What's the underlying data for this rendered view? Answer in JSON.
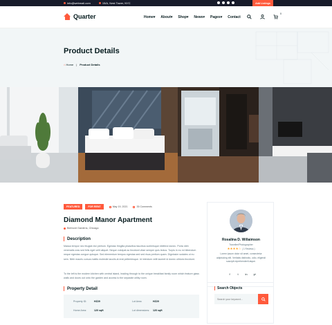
{
  "topbar": {
    "email": "info@webmail.com",
    "address": "15/A, Nest Tower, NYC",
    "cta": "Add Listings"
  },
  "brand": {
    "name": "Quarter"
  },
  "menu": {
    "items": [
      "Home",
      "About",
      "Shop",
      "News",
      "Pages",
      "Contact"
    ]
  },
  "cart": {
    "count": "0"
  },
  "hero": {
    "title": "Product Details",
    "crumb_home": "Home",
    "crumb_current": "Product Details"
  },
  "listing": {
    "badge1": "FEATURED",
    "badge2": "FOR RENT",
    "date": "May 19, 2021",
    "comments": "35 Comments",
    "title": "Diamond Manor Apartment",
    "location": "Belmont Gardens, Chicago",
    "description_heading": "Description",
    "description_p1": "Massa tempor nec feugiat nisl pretium. Egestas fringilla phasellus faucibus scelerisque eleifend donec. Porta nibh venenatis cras sed felis eget velit aliquet. Neque volutpat ac tincidunt vitae semper quis lectus. Turpis in eu mi bibendum neque egestas congue quisque. Sed elementum tempus egestas sed sed risus pretium quam. Dignissim sodales ut eu sem. Nibh mauris cursus mattis molestie iaculis at erat pellentesque. Id interdum velit laoreet id donec ultrices tincidunt.",
    "description_p2": "To the left is the modern kitchen with central island, leading through to the unique breakfast family room which feature glass walls and doors out onto the garden and access to the separate utility room.",
    "detail_heading": "Property Detail",
    "details": [
      {
        "l1": "Property ID:",
        "v1": "HZ29",
        "l2": "Lot Area:",
        "v2": "HZ29"
      },
      {
        "l1": "Home Area:",
        "v1": "120 sqft",
        "l2": "Lot dimensions:",
        "v2": "120 sqft"
      }
    ]
  },
  "agent": {
    "name": "Rosalina D. Willaimson",
    "role": "Traveller/Photographer",
    "stars": "★★★★☆",
    "reviews": "( 1 Reviews )",
    "bio": "Lorem ipsum dolor sit amet, consectetur adipisicing elit. Veritatis distinctio, odio, eligendi suscipit reprehenderit atque.",
    "socials": [
      "f",
      "t",
      "in",
      "yt"
    ]
  },
  "search": {
    "title": "Search Objects",
    "placeholder": "Search your keyword..."
  },
  "colors": {
    "accent": "#ff5a3c",
    "dark": "#071c1f",
    "topbar": "#171b2a"
  }
}
